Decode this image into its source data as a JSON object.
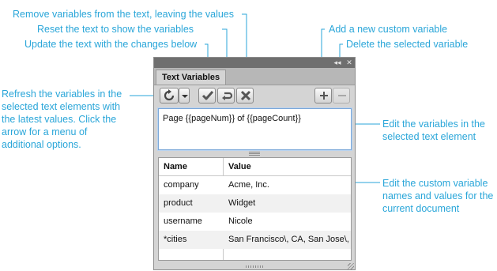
{
  "annotations": {
    "remove_variables": "Remove variables from the text, leaving the values",
    "reset_text": "Reset the text to show the variables",
    "update_text": "Update the text with the changes below",
    "add_variable": "Add a new custom variable",
    "delete_variable": "Delete the selected variable",
    "refresh": "Refresh the variables in the selected text elements with the latest values. Click the arrow for a menu of additional options.",
    "edit_variables": "Edit the variables in the selected text element",
    "edit_custom": "Edit the custom variable names and values for the current document"
  },
  "colors": {
    "annotation": "#2aa6d9",
    "panel": "#d4d4d4",
    "titlebar": "#6f6f6f"
  },
  "panel": {
    "title": "Text Variables",
    "titlebar_buttons": {
      "collapse": "◂◂",
      "close": "✕"
    },
    "text": "Page {{pageNum}} of {{pageCount}}",
    "table": {
      "headers": {
        "name": "Name",
        "value": "Value"
      },
      "rows": [
        {
          "name": "company",
          "value": "Acme, Inc."
        },
        {
          "name": "product",
          "value": "Widget"
        },
        {
          "name": "username",
          "value": "Nicole"
        },
        {
          "name": "*cities",
          "value": "San Francisco\\, CA, San Jose\\,"
        }
      ]
    }
  }
}
